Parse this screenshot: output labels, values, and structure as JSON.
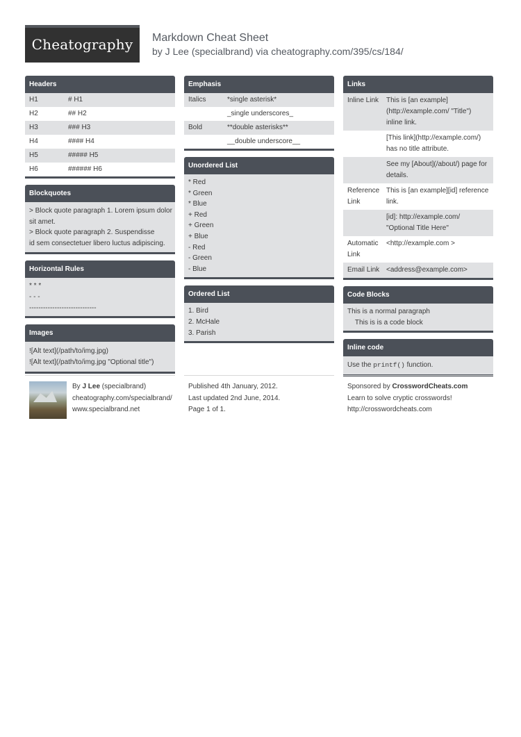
{
  "brand": {
    "logo": "Cheatography"
  },
  "doc": {
    "title": "Markdown Cheat Sheet",
    "subtitle": "by J Lee (specialbrand) via cheatography.com/395/cs/184/"
  },
  "headers": {
    "title": "Headers",
    "rows": [
      [
        "H1",
        "# H1"
      ],
      [
        "H2",
        "## H2"
      ],
      [
        "H3",
        "### H3"
      ],
      [
        "H4",
        "#### H4"
      ],
      [
        "H5",
        "##### H5"
      ],
      [
        "H6",
        "###### H6"
      ]
    ]
  },
  "blockquotes": {
    "title": "Blockquotes",
    "lines": [
      "> Block quote paragraph 1. Lorem ipsum dolor",
      "sit amet.",
      "> Block quote paragraph 2. Suspendisse",
      "id sem consectetuer libero luctus adipiscing."
    ]
  },
  "hrules": {
    "title": "Horizontal Rules",
    "lines": [
      "* * *",
      "- - -",
      "-----------------------------"
    ]
  },
  "images": {
    "title": "Images",
    "lines": [
      "![Alt text](/path/to/img.jpg)",
      "![Alt text](/path/to/img.jpg \"Optional title\")"
    ]
  },
  "emphasis": {
    "title": "Emphasis",
    "rows": [
      [
        "Italics",
        "*single asterisk*"
      ],
      [
        "",
        "_single underscores_"
      ],
      [
        "Bold",
        "**double asterisks**"
      ],
      [
        "",
        "__double underscore__"
      ]
    ]
  },
  "unordered": {
    "title": "Unordered List",
    "lines": [
      "* Red",
      "* Green",
      "* Blue",
      "+ Red",
      "+ Green",
      "+ Blue",
      "- Red",
      "- Green",
      "- Blue"
    ]
  },
  "ordered": {
    "title": "Ordered List",
    "lines": [
      "1. Bird",
      "2. McHale",
      "3. Parish"
    ]
  },
  "links": {
    "title": "Links",
    "rows": [
      [
        "Inline Link",
        "This is [an example] (http://example.com/ \"Title\") inline link."
      ],
      [
        "",
        "[This link](http://example.com/) has no title attribute."
      ],
      [
        "",
        "See my [About](/about/) page for details."
      ],
      [
        "Reference Link",
        "This is [an example][id] reference link."
      ],
      [
        "",
        "[id]: http://example.com/ \"Optional Title Here\""
      ],
      [
        "Automatic Link",
        "<http://example.com >"
      ],
      [
        "Email Link",
        "<address@example.com>"
      ]
    ]
  },
  "codeblocks": {
    "title": "Code Blocks",
    "lines": [
      "This is a normal paragraph",
      "    This is is a code block"
    ]
  },
  "inlinecode": {
    "title": "Inline code",
    "pre": "Use the ",
    "code": "printf()",
    "post": " function."
  },
  "footer": {
    "author_by": "By ",
    "author_name": "J Lee",
    "author_handle": " (specialbrand)",
    "author_url": "cheatography.com/specialbrand/",
    "author_site": "www.specialbrand.net",
    "published": "Published 4th January, 2012.",
    "updated": "Last updated 2nd June, 2014.",
    "page": "Page 1 of 1.",
    "sponsor_pre": "Sponsored by ",
    "sponsor_name": "CrosswordCheats.com",
    "sponsor_tag": "Learn to solve cryptic crosswords!",
    "sponsor_url": "http://crosswordcheats.com"
  }
}
